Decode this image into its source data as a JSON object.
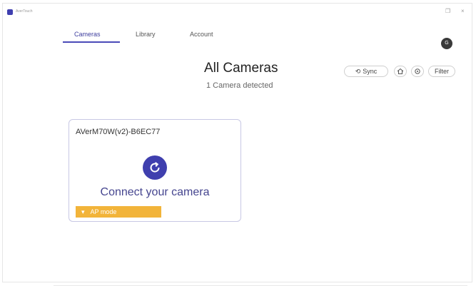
{
  "window": {
    "app_title": "AverTouch",
    "restore_glyph": "❐",
    "close_glyph": "×"
  },
  "tabs": [
    {
      "label": "Cameras",
      "active": true
    },
    {
      "label": "Library",
      "active": false
    },
    {
      "label": "Account",
      "active": false
    }
  ],
  "user": {
    "avatar_initial": "G"
  },
  "header": {
    "title": "All Cameras",
    "subtitle": "1 Camera detected"
  },
  "toolbar": {
    "sync_label": "Sync",
    "sync_icon": "sync-icon",
    "home_icon": "home-icon",
    "settings_icon": "gear-icon",
    "filter_label": "Filter"
  },
  "cameras": [
    {
      "name": "AVerM70W(v2)-B6EC77",
      "action_text": "Connect your camera",
      "mode_label": "AP mode",
      "mode_icon": "wifi-icon"
    }
  ],
  "colors": {
    "accent": "#3f3fae",
    "badge": "#f2b43a",
    "card_border": "#c8c8e4"
  }
}
